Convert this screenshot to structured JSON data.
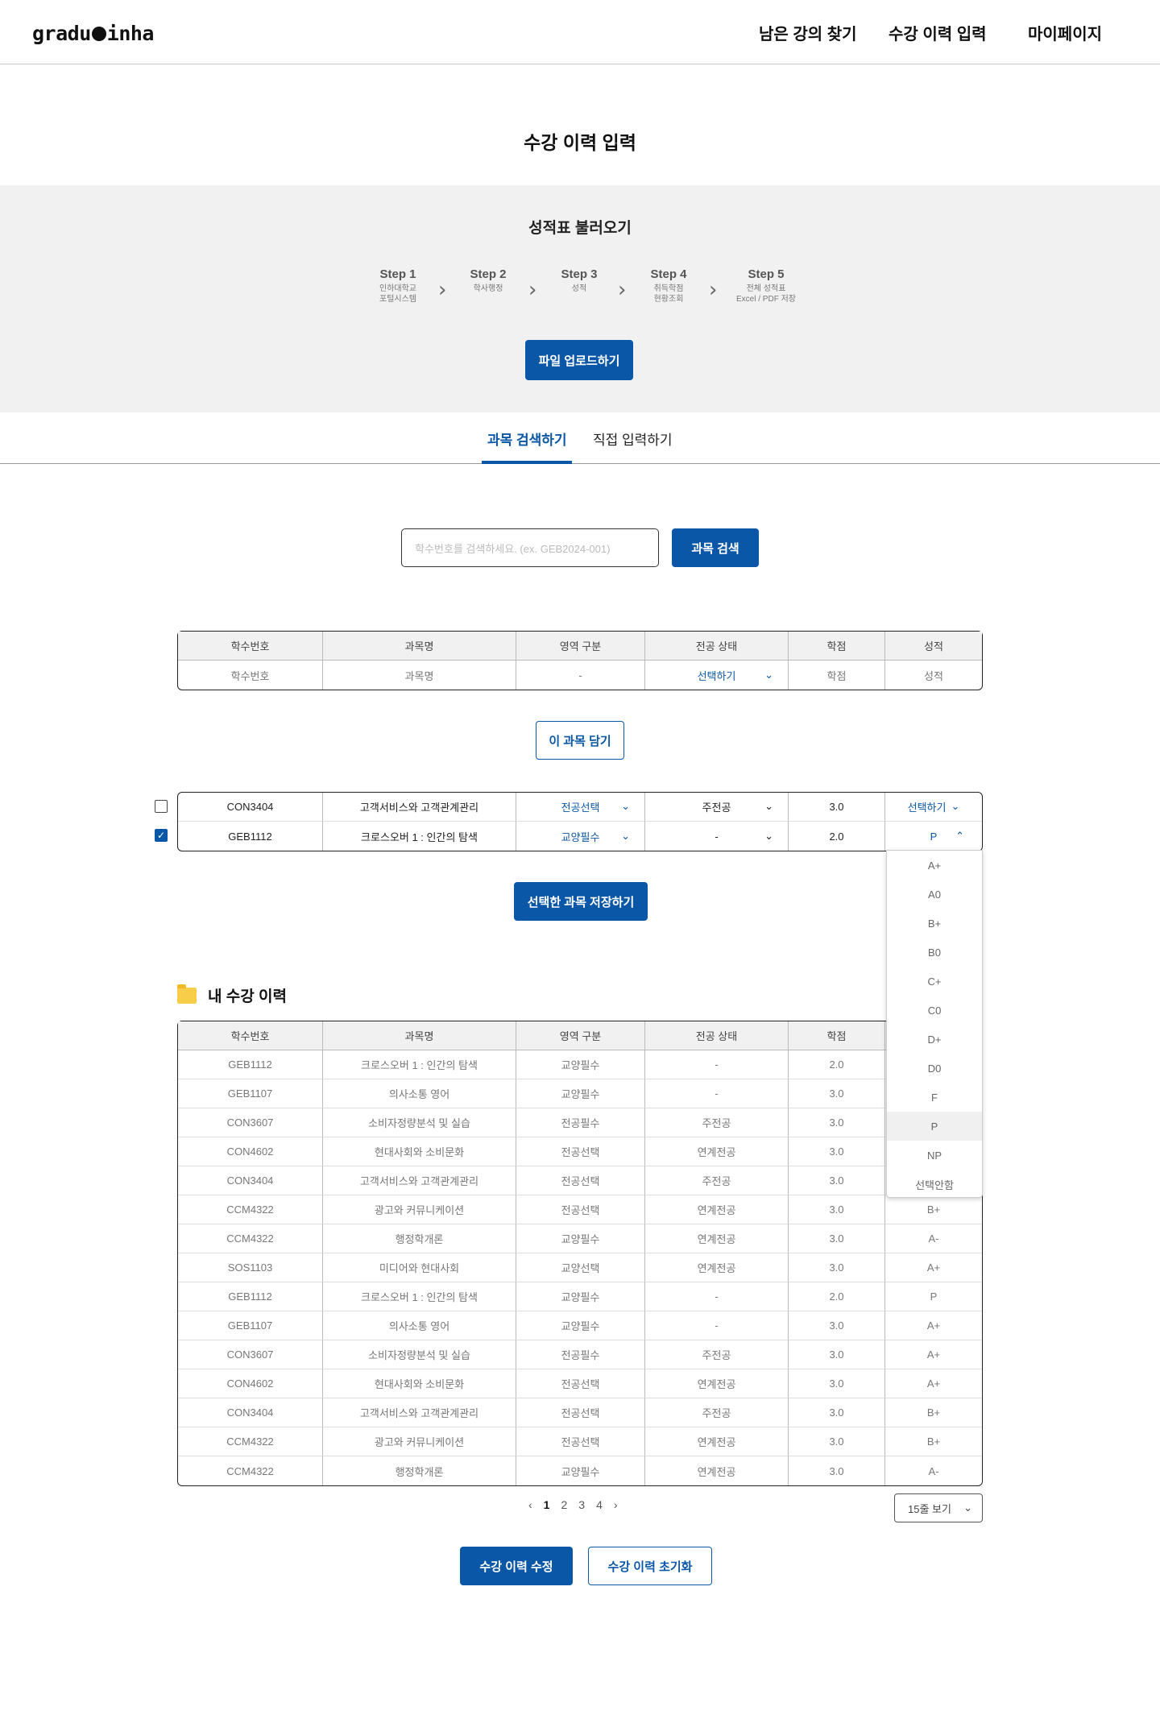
{
  "header": {
    "logo": "graduinha",
    "nav": [
      "남은 강의 찾기",
      "수강 이력 입력",
      "마이페이지"
    ]
  },
  "page_title": "수강 이력 입력",
  "import": {
    "title": "성적표 불러오기",
    "steps": [
      {
        "label": "Step 1",
        "desc1": "인하대학교",
        "desc2": "포털시스템"
      },
      {
        "label": "Step 2",
        "desc1": "학사행정",
        "desc2": ""
      },
      {
        "label": "Step 3",
        "desc1": "성적",
        "desc2": ""
      },
      {
        "label": "Step 4",
        "desc1": "취득학점",
        "desc2": "현황조회"
      },
      {
        "label": "Step 5",
        "desc1": "전체 성적표",
        "desc2": "Excel / PDF 저장"
      }
    ],
    "upload_button": "파일 업로드하기"
  },
  "tabs": [
    "과목 검색하기",
    "직접 입력하기"
  ],
  "search": {
    "placeholder": "학수번호를 검색하세요. (ex. GEB2024-001)",
    "button": "과목 검색"
  },
  "columns": [
    "학수번호",
    "과목명",
    "영역 구분",
    "전공 상태",
    "학점",
    "성적"
  ],
  "search_result": {
    "code": "학수번호",
    "name": "과목명",
    "area": "-",
    "major": "선택하기",
    "credit": "학점",
    "grade": "성적"
  },
  "add_button": "이 과목 담기",
  "cart": [
    {
      "checked": false,
      "code": "CON3404",
      "name": "고객서비스와 고객관계관리",
      "area": "전공선택",
      "major": "주전공",
      "credit": "3.0",
      "grade": "선택하기",
      "grade_arrow": "down"
    },
    {
      "checked": true,
      "code": "GEB1112",
      "name": "크로스오버 1 : 인간의 탐색",
      "area": "교양필수",
      "major": "-",
      "credit": "2.0",
      "grade": "P",
      "grade_arrow": "up"
    }
  ],
  "grade_options": [
    "A+",
    "A0",
    "B+",
    "B0",
    "C+",
    "C0",
    "D+",
    "D0",
    "F",
    "P",
    "NP",
    "선택안함"
  ],
  "grade_selected": "P",
  "save_button": "선택한 과목 저장하기",
  "history": {
    "title": "내 수강 이력",
    "rows": [
      {
        "code": "GEB1112",
        "name": "크로스오버 1 : 인간의 탐색",
        "area": "교양필수",
        "major": "-",
        "credit": "2.0",
        "grade": ""
      },
      {
        "code": "GEB1107",
        "name": "의사소통 영어",
        "area": "교양필수",
        "major": "-",
        "credit": "3.0",
        "grade": ""
      },
      {
        "code": "CON3607",
        "name": "소비자정량분석 및 실습",
        "area": "전공필수",
        "major": "주전공",
        "credit": "3.0",
        "grade": ""
      },
      {
        "code": "CON4602",
        "name": "현대사회와 소비문화",
        "area": "전공선택",
        "major": "연계전공",
        "credit": "3.0",
        "grade": ""
      },
      {
        "code": "CON3404",
        "name": "고객서비스와 고객관계관리",
        "area": "전공선택",
        "major": "주전공",
        "credit": "3.0",
        "grade": ""
      },
      {
        "code": "CCM4322",
        "name": "광고와 커뮤니케이션",
        "area": "전공선택",
        "major": "연계전공",
        "credit": "3.0",
        "grade": "B+"
      },
      {
        "code": "CCM4322",
        "name": "행정학개론",
        "area": "교양필수",
        "major": "연계전공",
        "credit": "3.0",
        "grade": "A-"
      },
      {
        "code": "SOS1103",
        "name": "미디어와 현대사회",
        "area": "교양선택",
        "major": "연계전공",
        "credit": "3.0",
        "grade": "A+"
      },
      {
        "code": "GEB1112",
        "name": "크로스오버 1 : 인간의 탐색",
        "area": "교양필수",
        "major": "-",
        "credit": "2.0",
        "grade": "P"
      },
      {
        "code": "GEB1107",
        "name": "의사소통 영어",
        "area": "교양필수",
        "major": "-",
        "credit": "3.0",
        "grade": "A+"
      },
      {
        "code": "CON3607",
        "name": "소비자정량분석 및 실습",
        "area": "전공필수",
        "major": "주전공",
        "credit": "3.0",
        "grade": "A+"
      },
      {
        "code": "CON4602",
        "name": "현대사회와 소비문화",
        "area": "전공선택",
        "major": "연계전공",
        "credit": "3.0",
        "grade": "A+"
      },
      {
        "code": "CON3404",
        "name": "고객서비스와 고객관계관리",
        "area": "전공선택",
        "major": "주전공",
        "credit": "3.0",
        "grade": "B+"
      },
      {
        "code": "CCM4322",
        "name": "광고와 커뮤니케이션",
        "area": "전공선택",
        "major": "연계전공",
        "credit": "3.0",
        "grade": "B+"
      },
      {
        "code": "CCM4322",
        "name": "행정학개론",
        "area": "교양필수",
        "major": "연계전공",
        "credit": "3.0",
        "grade": "A-"
      }
    ]
  },
  "pagination": {
    "prev": "‹",
    "pages": [
      "1",
      "2",
      "3",
      "4"
    ],
    "current": "1",
    "next": "›"
  },
  "per_page": "15줄 보기",
  "edit_button": "수강 이력 수정",
  "reset_button": "수강 이력 초기화",
  "colors": {
    "primary": "#0a57a7",
    "band": "#f1f1f1"
  }
}
